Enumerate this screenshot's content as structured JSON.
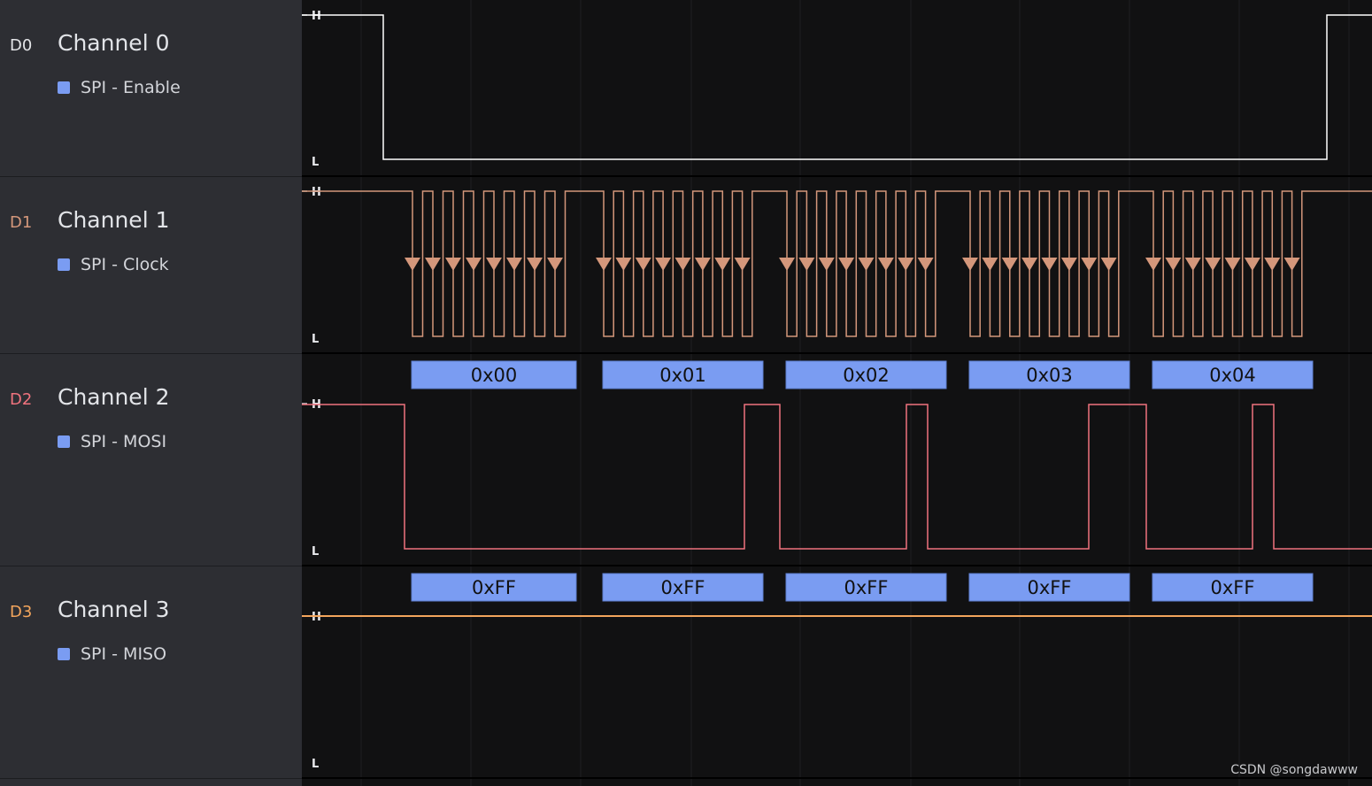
{
  "colors": {
    "sidebar_bg": "#2d2e33",
    "plot_bg": "#111112",
    "grid": "#1f2022",
    "separator": "#000000",
    "analyzer_fill": "#7a9cf2",
    "analyzer_text": "#111111"
  },
  "level_labels": {
    "high": "H",
    "low": "L"
  },
  "channels": [
    {
      "id": "D0",
      "name": "Channel 0",
      "analyzer": "SPI - Enable",
      "color": "#ffffff",
      "id_color": "#e4e5e8"
    },
    {
      "id": "D1",
      "name": "Channel 1",
      "analyzer": "SPI - Clock",
      "color": "#d4977b",
      "id_color": "#d4977b"
    },
    {
      "id": "D2",
      "name": "Channel 2",
      "analyzer": "SPI - MOSI",
      "color": "#f0737e",
      "id_color": "#f0737e"
    },
    {
      "id": "D3",
      "name": "Channel 3",
      "analyzer": "SPI - MISO",
      "color": "#f3a55c",
      "id_color": "#f3a55c"
    }
  ],
  "decoded": {
    "mosi_bytes": [
      "0x00",
      "0x01",
      "0x02",
      "0x03",
      "0x04"
    ],
    "miso_bytes": [
      "0xFF",
      "0xFF",
      "0xFF",
      "0xFF",
      "0xFF"
    ]
  },
  "edge_marker": "falling-edge-triangle",
  "watermark": "CSDN @songdawww"
}
